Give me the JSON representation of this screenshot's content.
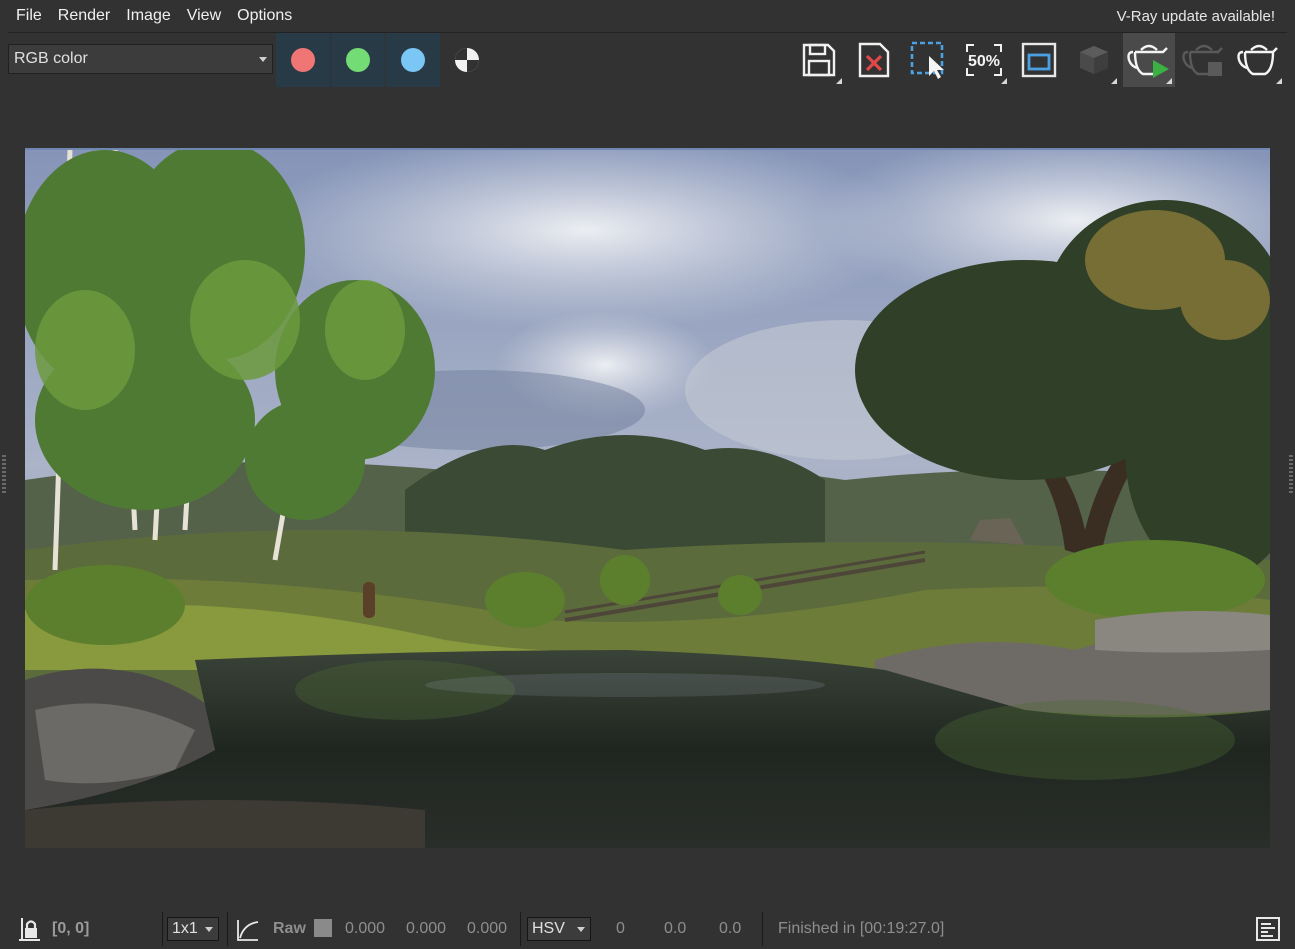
{
  "menu": {
    "items": [
      "File",
      "Render",
      "Image",
      "View",
      "Options"
    ],
    "update_notice": "V-Ray update available!"
  },
  "toolbar": {
    "channel_select_value": "RGB color",
    "channel_buttons": [
      {
        "name": "red-channel",
        "color": "#f07676"
      },
      {
        "name": "green-channel",
        "color": "#74dc74"
      },
      {
        "name": "blue-channel",
        "color": "#7ac6f4"
      }
    ],
    "buttons": [
      {
        "name": "save-image-icon"
      },
      {
        "name": "clear-image-icon"
      },
      {
        "name": "region-render-icon"
      },
      {
        "name": "zoom-50-icon",
        "label": "50%"
      },
      {
        "name": "frame-icon"
      },
      {
        "name": "render-cube-icon"
      },
      {
        "name": "start-interactive-render-icon"
      },
      {
        "name": "stop-render-icon"
      },
      {
        "name": "render-teapot-icon"
      }
    ]
  },
  "statusbar": {
    "coords": "[0, 0]",
    "zoom_select": "1x1",
    "raw_label": "Raw",
    "rgb_values": [
      "0.000",
      "0.000",
      "0.000"
    ],
    "color_mode_select": "HSV",
    "hsv_values": [
      "0",
      "0.0",
      "0.0"
    ],
    "status_text": "Finished in [00:19:27.0]"
  },
  "colors": {
    "background": "#323232",
    "channel_button_bg": "#283a46",
    "icon_accent": "#4aa0e0",
    "clear_accent": "#e04848",
    "play_accent": "#3cb043"
  }
}
